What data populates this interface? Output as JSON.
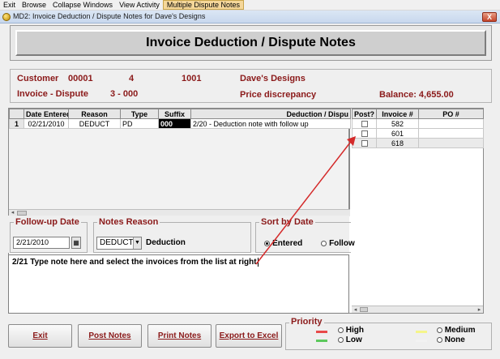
{
  "menubar": {
    "items": [
      {
        "label": "Exit"
      },
      {
        "label": "Browse"
      },
      {
        "label": "Collapse Windows"
      },
      {
        "label": "View Activity"
      },
      {
        "label": "Multiple Dispute Notes"
      }
    ]
  },
  "window": {
    "title": "MD2: Invoice Deduction / Dispute Notes for Dave's Designs",
    "close_label": "X"
  },
  "header": {
    "title": "Invoice Deduction / Dispute Notes"
  },
  "info": {
    "customer_label": "Customer",
    "customer_number": "00001",
    "field_a": "4",
    "field_b": "1001",
    "customer_name": "Dave's Designs",
    "invoice_label": "Invoice - Dispute",
    "invoice_value": "3 - 000",
    "reason_text": "Price discrepancy",
    "balance": "Balance: 4,655.00"
  },
  "notes_grid": {
    "columns": [
      "",
      "Date Entered",
      "Reason",
      "Type",
      "Suffix",
      "Deduction / Dispu"
    ],
    "rows": [
      {
        "num": "1",
        "date": "02/21/2010",
        "reason": "DEDUCT",
        "type": "PD",
        "suffix": "000",
        "note": "2/20 - Deduction note with follow up"
      }
    ]
  },
  "invoice_grid": {
    "columns": [
      "Post?",
      "Invoice #",
      "PO #"
    ],
    "rows": [
      {
        "invoice": "582",
        "po": ""
      },
      {
        "invoice": "601",
        "po": ""
      },
      {
        "invoice": "618",
        "po": ""
      }
    ]
  },
  "followup": {
    "label": "Follow-up Date",
    "value": "2/21/2010",
    "cal_icon": "calendar-icon"
  },
  "notes_reason": {
    "label": "Notes Reason",
    "selected": "DEDUCT",
    "description": "Deduction"
  },
  "sort_by": {
    "label": "Sort by Date",
    "options": [
      "Entered",
      "Follow"
    ],
    "selected": "Entered"
  },
  "note_text": "2/21 Type note here and select the invoices from the list at right",
  "buttons": {
    "exit": "Exit",
    "post_notes": "Post Notes",
    "print_notes": "Print Notes",
    "export": "Export to Excel"
  },
  "priority": {
    "label": "Priority",
    "options": [
      {
        "label": "High",
        "color": "#e84a4a"
      },
      {
        "label": "Low",
        "color": "#5cc85c"
      },
      {
        "label": "Medium",
        "color": "#f5f58a"
      },
      {
        "label": "None",
        "color": "#f2f2f2"
      }
    ]
  },
  "colors": {
    "accent_text": "#8b1a1a",
    "arrow": "#d42a2a"
  }
}
